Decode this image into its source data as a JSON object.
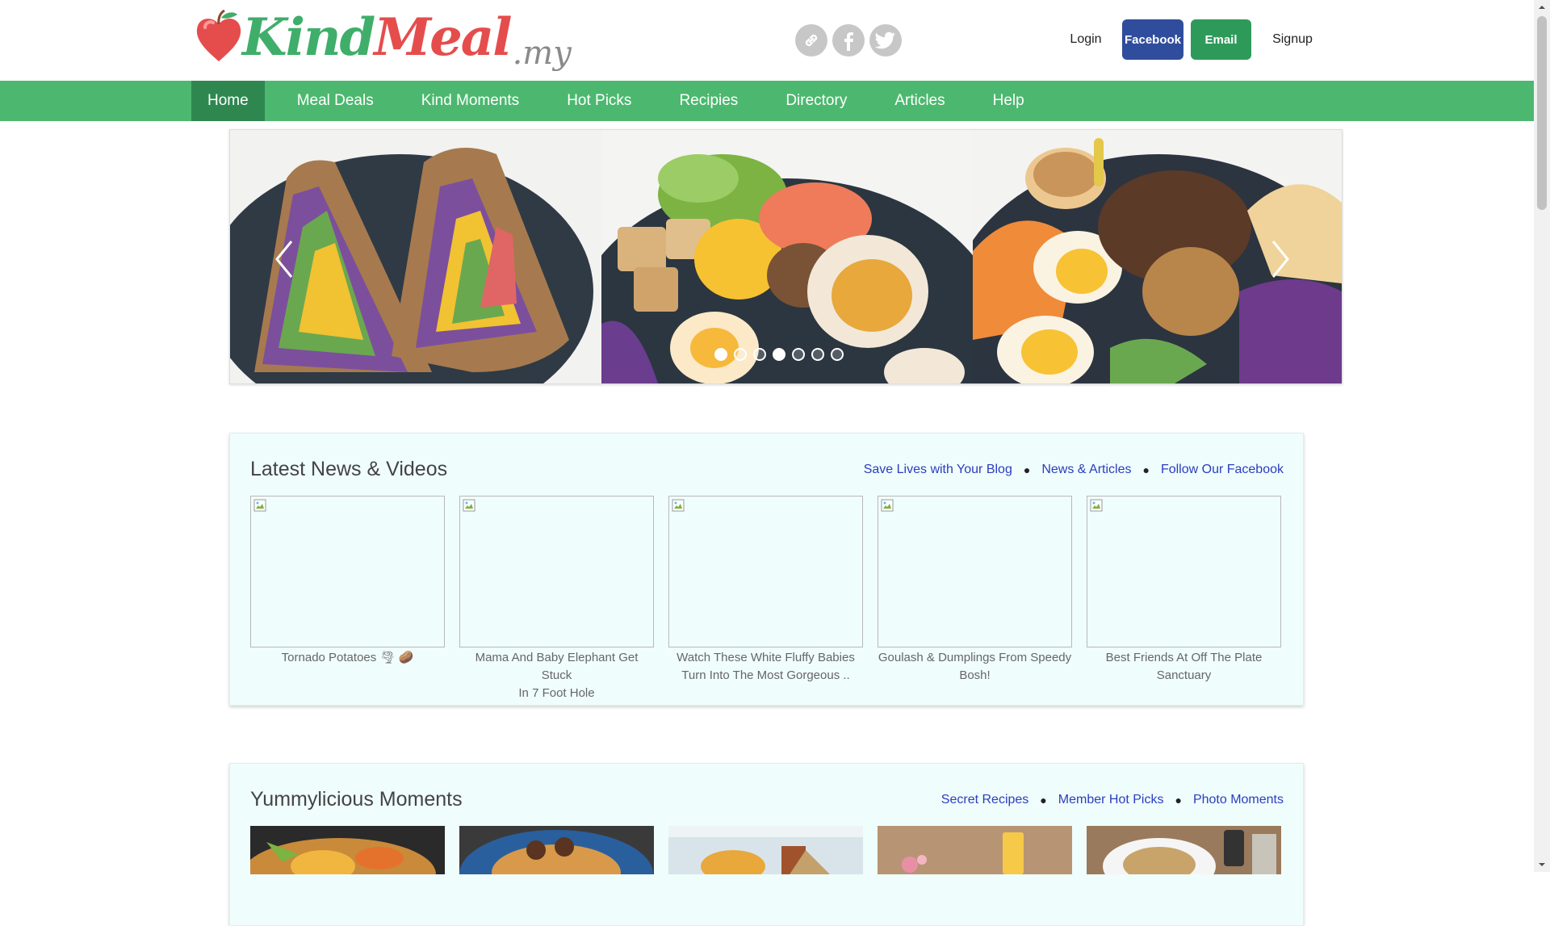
{
  "header": {
    "logo": {
      "kind": "Kind",
      "meal": "Meal",
      "suffix": ".my",
      "brand_green": "#3fae6a",
      "brand_red": "#e54d4d"
    },
    "social_icons": [
      "link-icon",
      "facebook-icon",
      "twitter-icon"
    ],
    "login_label": "Login",
    "facebook_label": "Facebook",
    "email_label": "Email",
    "signup_label": "Signup"
  },
  "nav": {
    "items": [
      {
        "label": "Home",
        "active": true
      },
      {
        "label": "Meal Deals"
      },
      {
        "label": "Kind Moments"
      },
      {
        "label": "Hot Picks"
      },
      {
        "label": "Recipies"
      },
      {
        "label": "Directory"
      },
      {
        "label": "Articles"
      },
      {
        "label": "Help"
      }
    ],
    "bg_color": "#4cb86f",
    "active_color": "#2f8750"
  },
  "carousel": {
    "slides": [
      "sandwich-photo",
      "salad-bowl-photo",
      "soba-noodle-bowl-photo"
    ],
    "dot_count": 7,
    "active_dot": 1
  },
  "news": {
    "title": "Latest News & Videos",
    "links": [
      "Save Lives with Your Blog",
      "News & Articles",
      "Follow Our Facebook"
    ],
    "cards": [
      {
        "caption_line1": "Tornado Potatoes 🌪 🥔",
        "caption_line2": ""
      },
      {
        "caption_line1": "Mama And Baby Elephant Get Stuck",
        "caption_line2": "In 7 Foot Hole"
      },
      {
        "caption_line1": "Watch These White Fluffy Babies",
        "caption_line2": "Turn Into The Most Gorgeous .."
      },
      {
        "caption_line1": "Goulash & Dumplings From Speedy",
        "caption_line2": "Bosh!"
      },
      {
        "caption_line1": "Best Friends At Off The Plate",
        "caption_line2": "Sanctuary"
      }
    ]
  },
  "moments": {
    "title": "Yummylicious Moments",
    "links": [
      "Secret Recipes",
      "Member Hot Picks",
      "Photo Moments"
    ],
    "photos": [
      "noodle-dish-photo",
      "spaghetti-meatballs-photo",
      "cafe-drink-photo",
      "orange-juice-table-photo",
      "rice-plate-table-photo"
    ]
  }
}
